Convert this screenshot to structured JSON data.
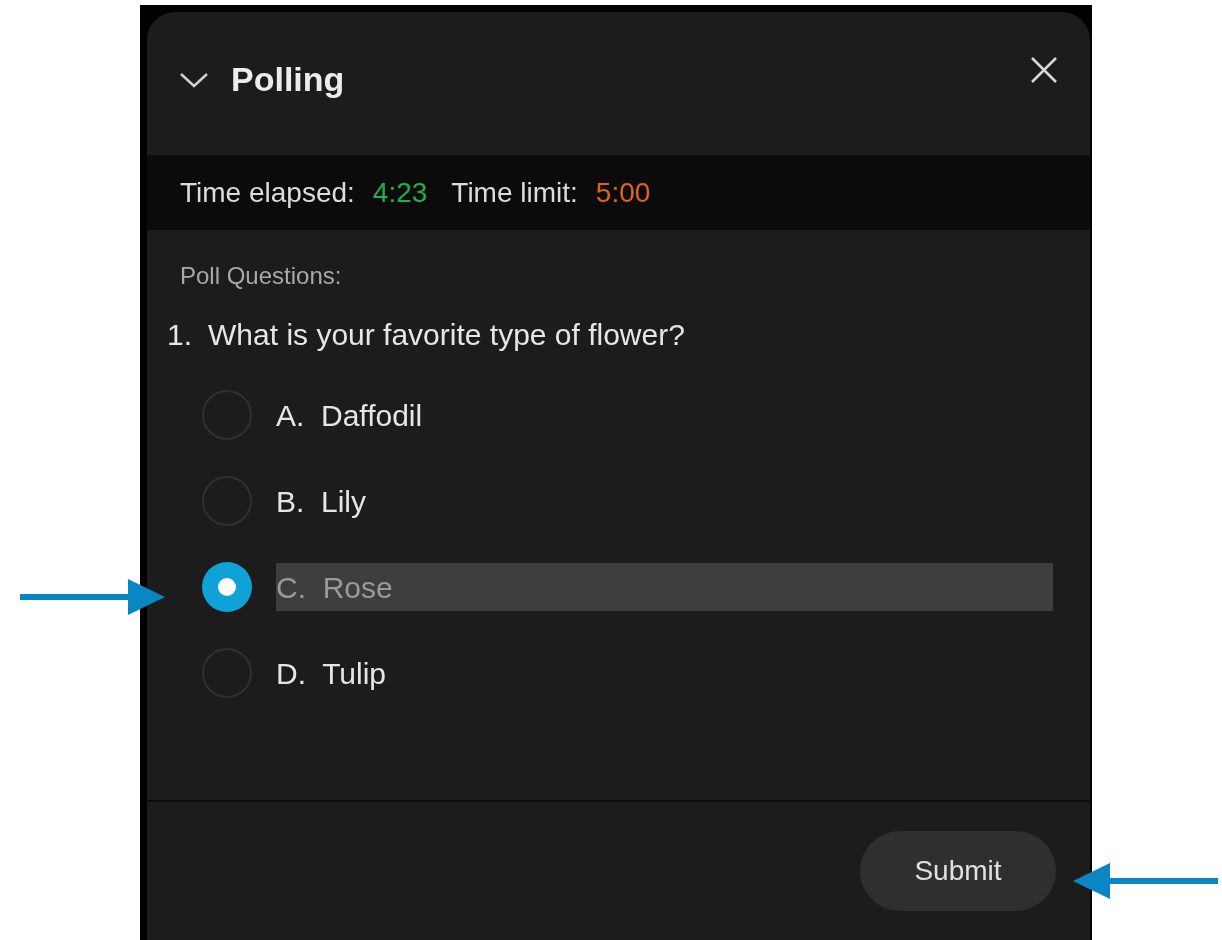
{
  "panel": {
    "title": "Polling"
  },
  "timer": {
    "elapsed_label": "Time elapsed:",
    "elapsed": "4:23",
    "limit_label": "Time limit:",
    "limit": "5:00"
  },
  "section_label": "Poll Questions:",
  "question": {
    "number": "1.",
    "text": "What is your favorite type of flower?"
  },
  "options": [
    {
      "letter": "A.",
      "text": "Daffodil",
      "selected": false
    },
    {
      "letter": "B.",
      "text": "Lily",
      "selected": false
    },
    {
      "letter": "C.",
      "text": "Rose",
      "selected": true
    },
    {
      "letter": "D.",
      "text": "Tulip",
      "selected": false
    }
  ],
  "submit": "Submit",
  "annotations": [
    {
      "kind": "arrow_right"
    },
    {
      "kind": "arrow_left"
    }
  ]
}
